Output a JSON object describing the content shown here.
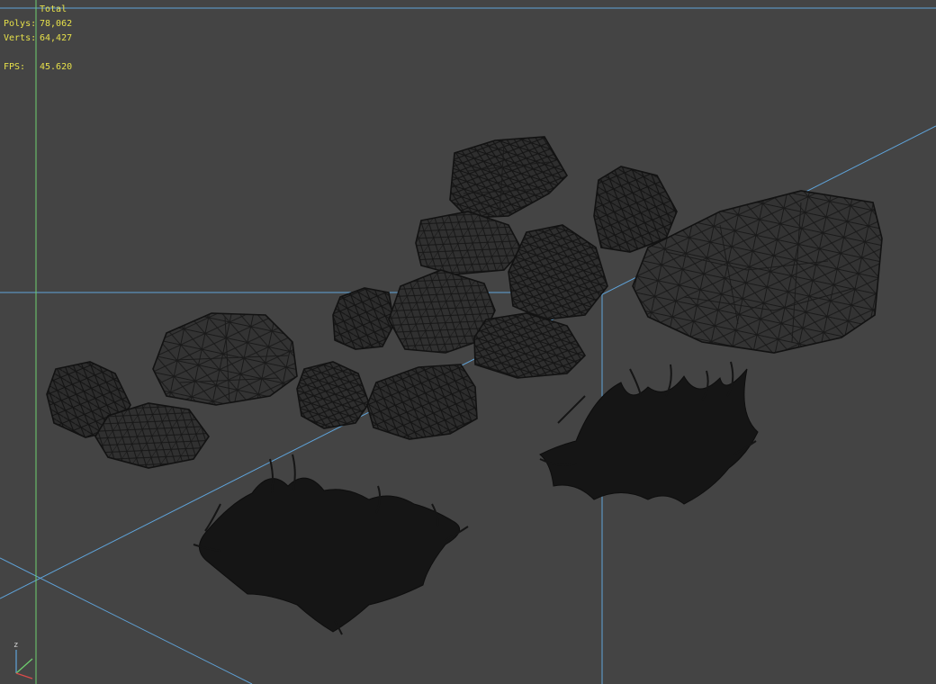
{
  "stats": {
    "header": "Total",
    "polys_label": "Polys:",
    "polys_value": "78,062",
    "verts_label": "Verts:",
    "verts_value": "64,427",
    "fps_label": "FPS:",
    "fps_value": "45.620"
  },
  "gizmo": {
    "z_label": "z"
  },
  "colors": {
    "background": "#444444",
    "grid_line": "#5fa3d9",
    "vertical_axis": "#6fd06f",
    "stats_text": "#e6e04a",
    "wire": "#141414",
    "fill": "#2e2e2e"
  },
  "scene": {
    "rock_count": 15,
    "grass_clumps": 2
  }
}
